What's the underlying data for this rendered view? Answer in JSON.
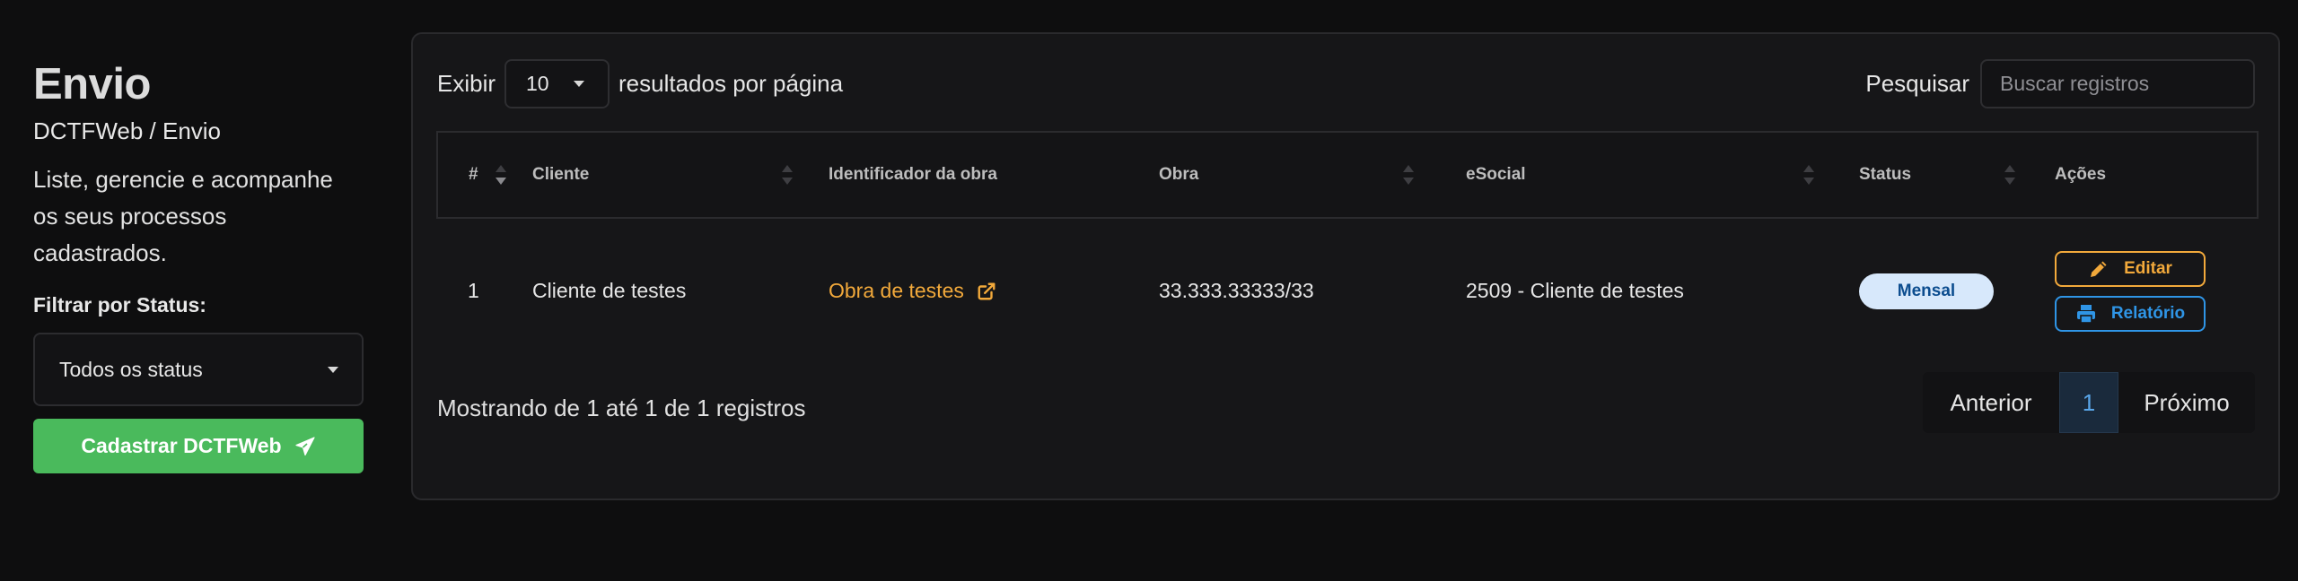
{
  "sidebar": {
    "title": "Envio",
    "breadcrumb": "DCTFWeb / Envio",
    "description": "Liste, gerencie e acompanhe os seus processos cadastrados.",
    "filter_label": "Filtrar por Status:",
    "filter_value": "Todos os status",
    "create_button": "Cadastrar DCTFWeb"
  },
  "table_controls": {
    "show_label": "Exibir",
    "page_length": "10",
    "per_page_label": "resultados por página",
    "search_label": "Pesquisar",
    "search_placeholder": "Buscar registros"
  },
  "table": {
    "columns": [
      "#",
      "Cliente",
      "Identificador da obra",
      "Obra",
      "eSocial",
      "Status",
      "Ações"
    ],
    "rows": [
      {
        "id": "1",
        "cliente": "Cliente de testes",
        "identificador": "Obra de testes",
        "obra": "33.333.33333/33",
        "esocial": "2509 - Cliente de testes",
        "status": "Mensal",
        "actions": [
          "Editar",
          "Relatório"
        ]
      }
    ]
  },
  "footer": {
    "info": "Mostrando de 1 até 1 de 1 registros",
    "prev": "Anterior",
    "current_page": "1",
    "next": "Próximo"
  },
  "colors": {
    "background": "#0e0e0f",
    "card": "#161618",
    "create_button": "#4aba5c",
    "link_orange": "#f2a93b",
    "report_blue": "#2f95e6",
    "badge_bg": "#d7e8fb",
    "badge_text": "#0c4d8f"
  },
  "icons": [
    "paper-plane-icon",
    "external-link-icon",
    "pencil-icon",
    "printer-icon",
    "caret-down-icon",
    "sort-icon"
  ]
}
